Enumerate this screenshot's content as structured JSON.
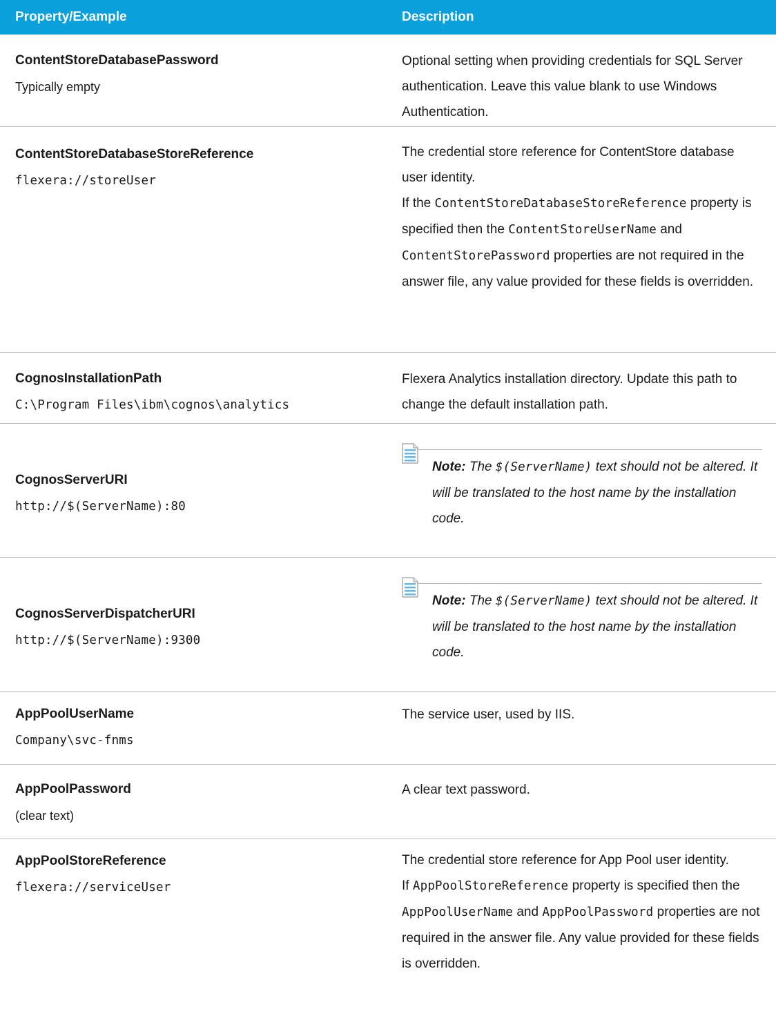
{
  "header": {
    "col1": "Property/Example",
    "col2": "Description"
  },
  "rows": [
    {
      "name": "ContentStoreDatabasePassword",
      "example": "Typically empty",
      "desc": "Optional setting when providing credentials for SQL Server authentication. Leave this value blank to use Windows Authentication."
    },
    {
      "name": "ContentStoreDatabaseStoreReference",
      "example": "flexera://storeUser",
      "desc1": "The credential store reference for ContentStore database user identity.",
      "desc2_pre": "If the ",
      "desc2_code1": "ContentStoreDatabaseStoreReference",
      "desc2_mid1": " property is specified then the ",
      "desc2_code2": "ContentStoreUserName",
      "desc2_mid2": " and ",
      "desc2_code3": "ContentStorePassword",
      "desc2_post": " properties are not required in the answer file, any value provided for these fields is overridden."
    },
    {
      "name": "CognosInstallationPath",
      "example": "C:\\Program Files\\ibm\\cognos\\analytics",
      "desc": "Flexera Analytics installation directory. Update this path to change the default installation path."
    },
    {
      "name": "CognosServerURI",
      "example": "http://$(ServerName):80",
      "note_label": "Note:",
      "note_pre": " The ",
      "note_code": "$(ServerName)",
      "note_post": " text should not be altered. It will be translated to the host name by the installation code."
    },
    {
      "name": "CognosServerDispatcherURI",
      "example": "http://$(ServerName):9300",
      "note_label": "Note:",
      "note_pre": " The ",
      "note_code": "$(ServerName)",
      "note_post": " text should not be altered. It will be translated to the host name by the installation code."
    },
    {
      "name": "AppPoolUserName",
      "example": "Company\\svc-fnms",
      "desc": "The service user, used by IIS."
    },
    {
      "name": "AppPoolPassword",
      "example": "(clear text)",
      "desc": "A clear text password."
    },
    {
      "name": "AppPoolStoreReference",
      "example": "flexera://serviceUser",
      "desc1": "The credential store reference for App Pool user identity.",
      "desc2_pre": "If ",
      "desc2_code1": "AppPoolStoreReference",
      "desc2_mid1": " property is specified then the ",
      "desc2_code2": "AppPoolUserName",
      "desc2_mid2": " and ",
      "desc2_code3": "AppPoolPassword",
      "desc2_post": " properties are not required in the answer file. Any value provided for these fields is overridden."
    }
  ],
  "colors": {
    "header_bg": "#0aa0dc",
    "header_text": "#ffffff",
    "row_divider": "#b7b7b7"
  }
}
